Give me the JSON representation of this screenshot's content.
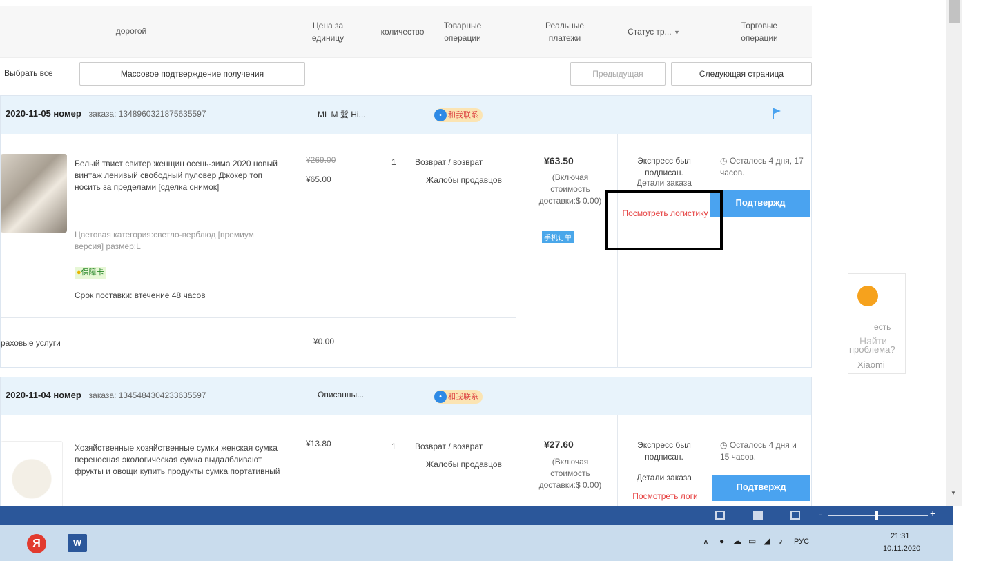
{
  "header": {
    "col_product": "дорогой",
    "col_unit_price": "Цена за единицу",
    "col_qty": "количество",
    "col_goods_ops": "Товарные операции",
    "col_payments": "Реальные платежи",
    "col_status": "Статус тр...",
    "col_trade_ops": "Торговые операции"
  },
  "toolbar": {
    "select_all": "Выбрать все",
    "bulk_confirm": "Массовое подтверждение получения",
    "prev": "Предыдущая",
    "next": "Следующая страница"
  },
  "orders": [
    {
      "date": "2020-11-05 номер",
      "order_label": "заказа: 1348960321875635597",
      "seller": "ML M 髮 Hi...",
      "contact": "和我联系",
      "title": "Белый твист свитер женщин осень-зима 2020 новый винтаж ленивый свободный пуловер Джокер топ носить за пределами [сделка снимок]",
      "variant": "Цветовая категория:светло-верблюд [премиум версия] размер:L",
      "guarantee": "保障卡",
      "delivery": "Срок поставки: втечение 48 часов",
      "old_price": "¥269.00",
      "price": "¥65.00",
      "qty": "1",
      "goods_op1": "Возврат / возврат",
      "goods_op2": "Жалобы продавцов",
      "pay": "¥63.50",
      "pay_note": "(Включая стоимость доставки:$ 0.00)",
      "pay_tag": "手机订单",
      "status1": "Экспресс был подписан.",
      "status2": "Детали заказа",
      "status3": "Посмотреть логистику",
      "remaining": "Осталось 4 дня, 17 часов.",
      "confirm": "Подтвержд",
      "insurance": "раховые услуги",
      "insurance_price": "¥0.00"
    },
    {
      "date": "2020-11-04 номер",
      "order_label": "заказа: 1345484304233635597",
      "seller": "Описанны...",
      "contact": "和我联系",
      "title": "Хозяйственные хозяйственные сумки женская сумка переносная экологическая сумка выдалбливают фрукты и овощи купить продукты сумка портативный",
      "price": "¥13.80",
      "qty": "1",
      "goods_op1": "Возврат / возврат",
      "goods_op2": "Жалобы продавцов",
      "pay": "¥27.60",
      "pay_note": "(Включая стоимость доставки:$ 0.00)",
      "status1": "Экспресс был подписан.",
      "status2": "Детали заказа",
      "status3": "Посмотреть логи",
      "remaining": "Осталось 4 дня и 15 часов.",
      "confirm": "Подтвержд"
    }
  ],
  "helper": {
    "line1": "есть",
    "line2": "Найти",
    "line3": "проблема?",
    "line4": "Xiaomi"
  },
  "taskbar": {
    "lang": "РУС",
    "time": "21:31",
    "date": "10.11.2020"
  },
  "colors": {
    "accent_blue": "#4aa3f0",
    "link_red": "#e64040",
    "word_blue": "#2b579a"
  }
}
